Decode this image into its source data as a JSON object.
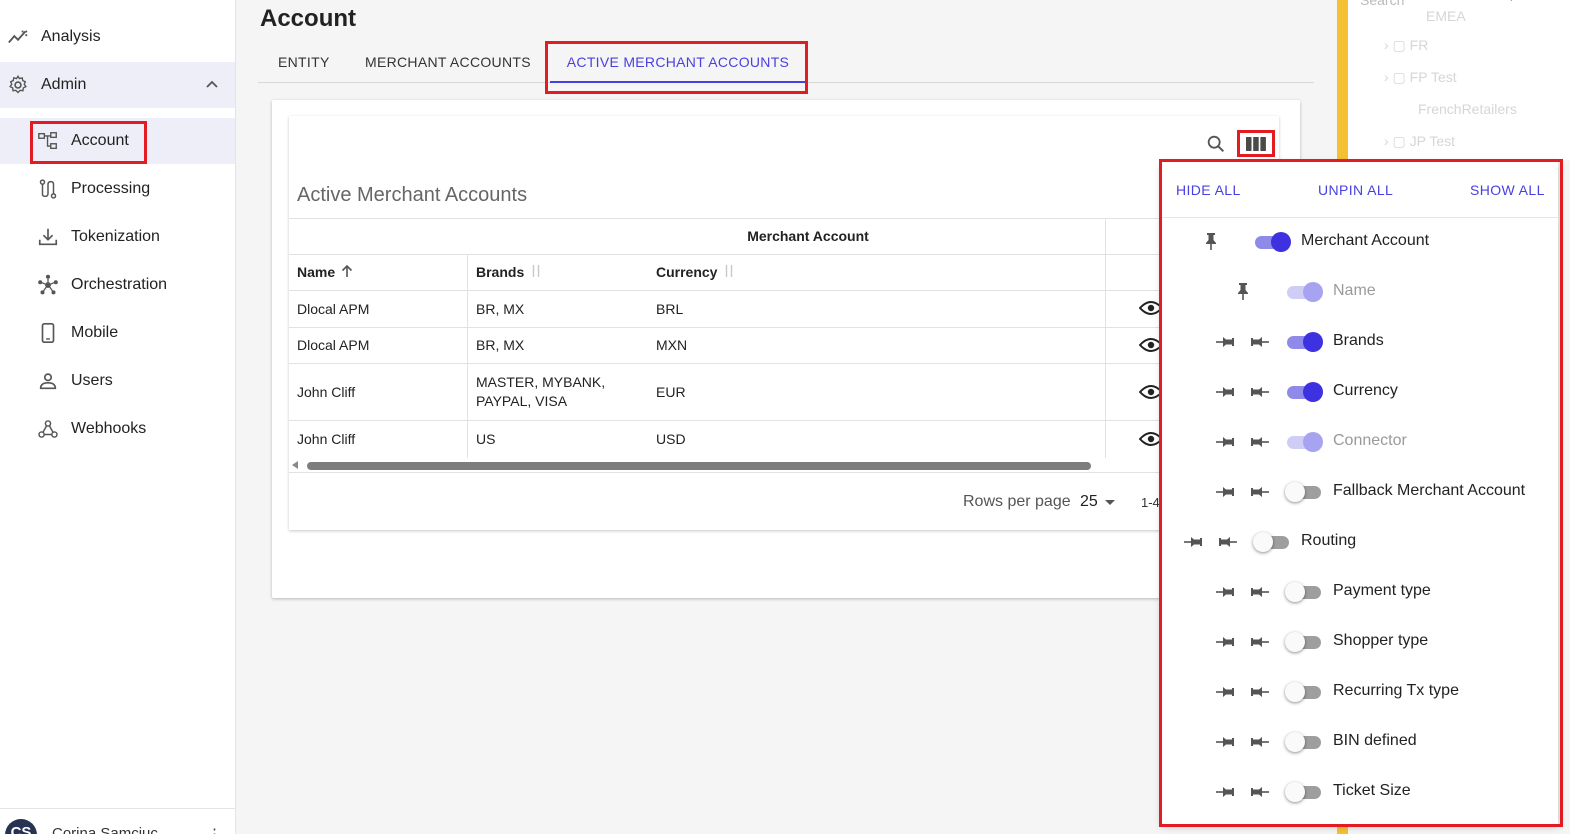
{
  "sidebar": {
    "items": [
      {
        "label": "Analysis",
        "icon": "trending-up-icon"
      },
      {
        "label": "Admin",
        "icon": "gear-icon"
      },
      {
        "label": "Account",
        "icon": "account-tree-icon"
      },
      {
        "label": "Processing",
        "icon": "route-icon"
      },
      {
        "label": "Tokenization",
        "icon": "download-icon"
      },
      {
        "label": "Orchestration",
        "icon": "hub-icon"
      },
      {
        "label": "Mobile",
        "icon": "phone-icon"
      },
      {
        "label": "Users",
        "icon": "person-icon"
      },
      {
        "label": "Webhooks",
        "icon": "webhook-icon"
      }
    ],
    "user": {
      "initials": "CS",
      "name": "Corina Samciuc"
    }
  },
  "page": {
    "title": "Account"
  },
  "tabs": [
    {
      "label": "ENTITY"
    },
    {
      "label": "MERCHANT ACCOUNTS"
    },
    {
      "label": "ACTIVE MERCHANT ACCOUNTS",
      "active": true
    }
  ],
  "table": {
    "title": "Active Merchant Accounts",
    "group_header": "Merchant Account",
    "columns": [
      {
        "label": "Name",
        "sort": "asc"
      },
      {
        "label": "Brands",
        "sort": "none"
      },
      {
        "label": "Currency",
        "sort": "none"
      }
    ],
    "rows": [
      {
        "name": "Dlocal APM",
        "brands": "BR, MX",
        "currency": "BRL"
      },
      {
        "name": "Dlocal APM",
        "brands": "BR, MX",
        "currency": "MXN"
      },
      {
        "name": "John Cliff",
        "brands": "MASTER, MYBANK, PAYPAL, VISA",
        "currency": "EUR"
      },
      {
        "name": "John Cliff",
        "brands": "US",
        "currency": "USD"
      }
    ],
    "rows_per_page_label": "Rows per page",
    "rows_per_page": "25",
    "range": "1-4"
  },
  "tree_panel": {
    "search_placeholder": "Search",
    "items": [
      "EMEA",
      "FR",
      "FP Test",
      "FrenchRetailers",
      "JP Test"
    ]
  },
  "columns_panel": {
    "actions": {
      "hide_all": "HIDE ALL",
      "unpin_all": "UNPIN ALL",
      "show_all": "SHOW ALL"
    },
    "columns": [
      {
        "label": "Merchant Account",
        "state": "on",
        "level": 0
      },
      {
        "label": "Name",
        "state": "on-disabled",
        "level": 1
      },
      {
        "label": "Brands",
        "state": "on",
        "level": 1
      },
      {
        "label": "Currency",
        "state": "on",
        "level": 1
      },
      {
        "label": "Connector",
        "state": "on-disabled",
        "level": 1
      },
      {
        "label": "Fallback Merchant Account",
        "state": "off",
        "level": 1
      },
      {
        "label": "Routing",
        "state": "off",
        "level": 0
      },
      {
        "label": "Payment type",
        "state": "off",
        "level": 1
      },
      {
        "label": "Shopper type",
        "state": "off",
        "level": 1
      },
      {
        "label": "Recurring Tx type",
        "state": "off",
        "level": 1
      },
      {
        "label": "BIN defined",
        "state": "off",
        "level": 1
      },
      {
        "label": "Ticket Size",
        "state": "off",
        "level": 1
      }
    ]
  },
  "colors": {
    "accent": "#4a3fe0",
    "highlight": "#e31b23",
    "sidebar_active": "#eeeef8"
  }
}
